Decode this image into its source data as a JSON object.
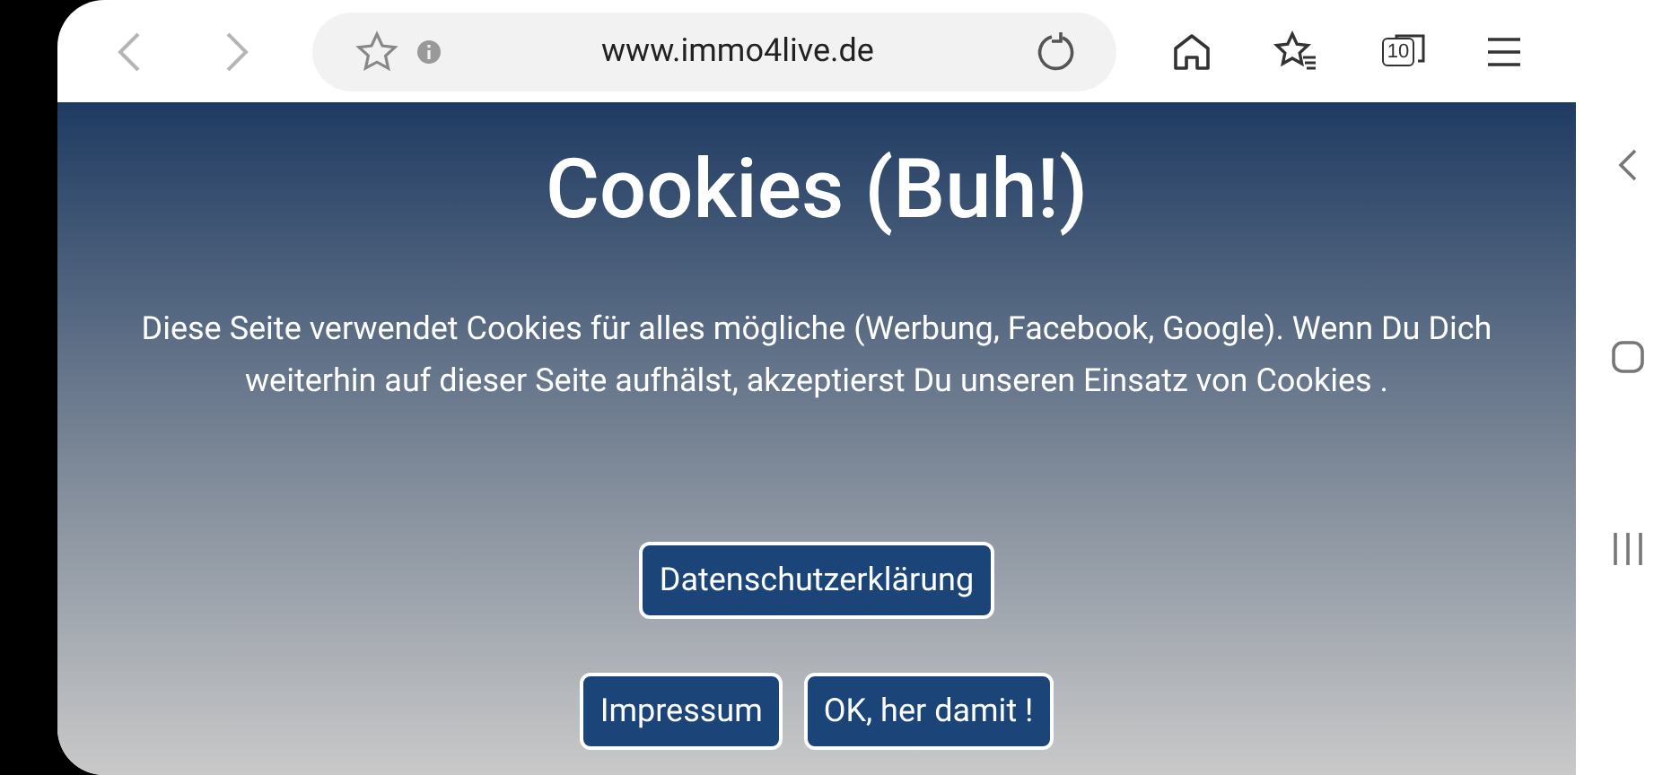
{
  "browser": {
    "back": {
      "disabled": true
    },
    "forward": {
      "disabled": true
    },
    "url": "www.immo4live.de",
    "tab_count": "10"
  },
  "banner": {
    "title": "Cookies (Buh!)",
    "text": "Diese Seite verwendet Cookies für alles mögliche (Werbung, Facebook, Google). Wenn Du Dich weiterhin auf dieser Seite aufhälst, akzeptierst Du unseren Einsatz von Cookies .",
    "buttons": [
      [
        "Datenschutzerklärung"
      ],
      [
        "Impressum",
        "OK, her damit !"
      ]
    ]
  }
}
